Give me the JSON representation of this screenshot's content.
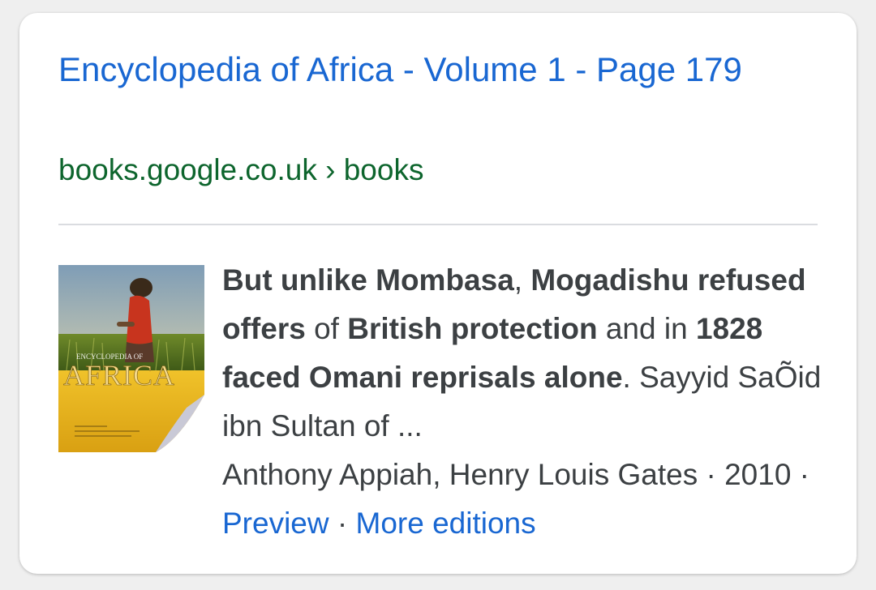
{
  "result": {
    "title": "Encyclopedia of Africa - Volume 1 - Page 179",
    "source": "books.google.co.uk › books",
    "snippet": {
      "bold1": "But unlike Mombasa",
      "plain1": ", ",
      "bold2": "Mogadishu refused offers",
      "plain2": " of ",
      "bold3": "British protection",
      "plain3": " and in ",
      "bold4": "1828 faced Omani reprisals alone",
      "plain4": ". Sayyid SaÕid ibn Sultan of ..."
    },
    "authors": "Anthony Appiah, Henry Louis Gates",
    "separator": " · ",
    "year": "2010",
    "preview_label": "Preview",
    "more_editions_label": "More editions",
    "thumbnail": {
      "cover_title": "AFRICA",
      "cover_subtitle": "ENCYCLOPEDIA OF",
      "icon": "book-cover-thumbnail"
    }
  },
  "colors": {
    "link": "#1967d2",
    "source": "#0d652d",
    "text": "#3c4043",
    "cover_yellow": "#e7b21c"
  }
}
